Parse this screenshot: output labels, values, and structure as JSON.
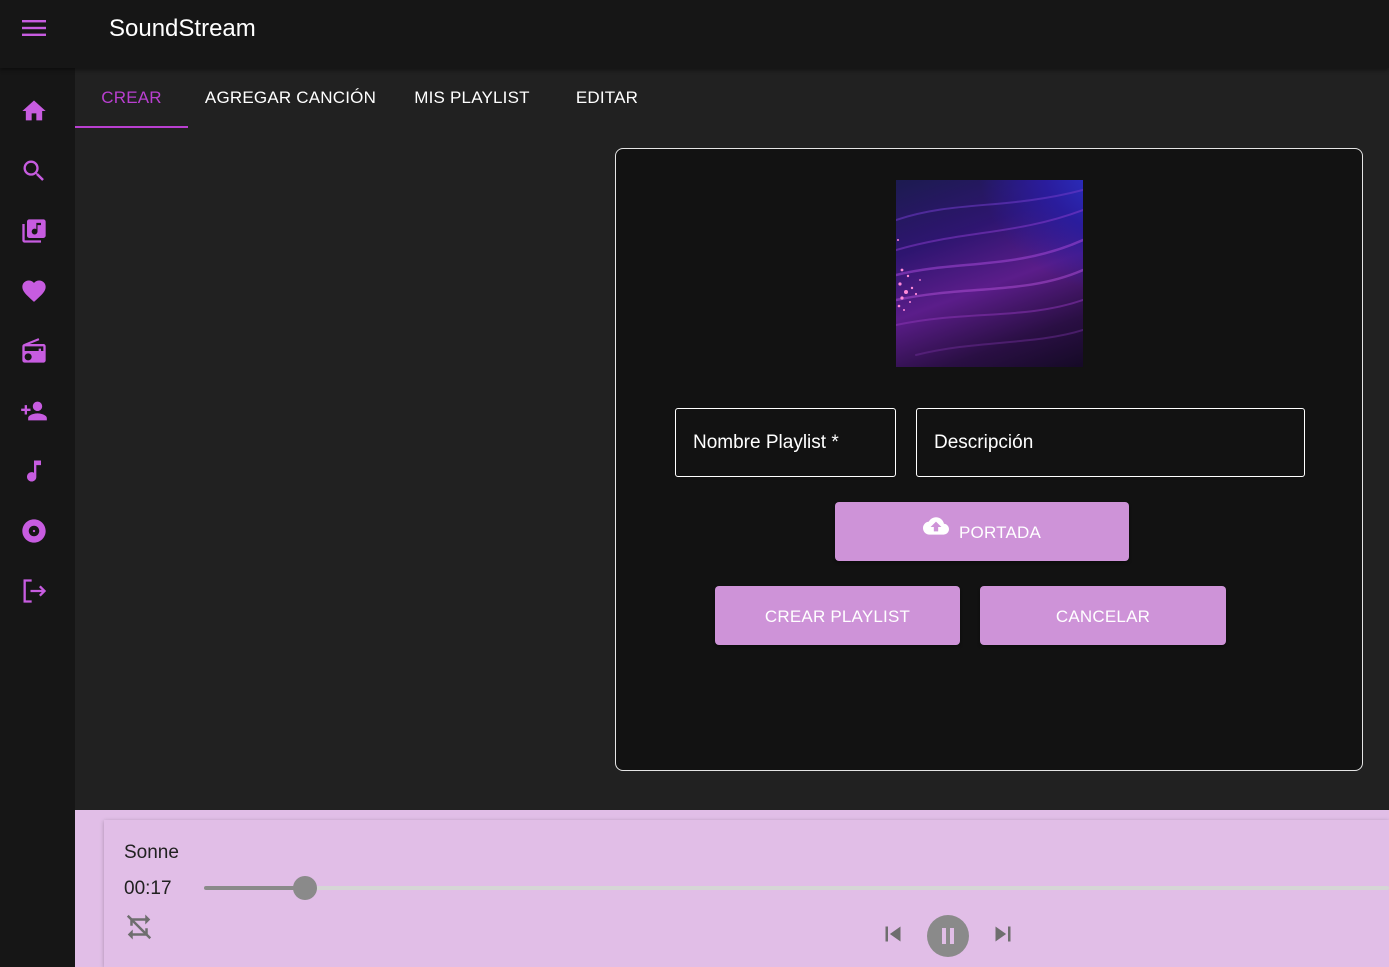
{
  "app": {
    "title": "SoundStream"
  },
  "sidebar": {
    "items": [
      {
        "icon": "home-icon"
      },
      {
        "icon": "search-icon"
      },
      {
        "icon": "library-music-icon"
      },
      {
        "icon": "heart-icon"
      },
      {
        "icon": "radio-icon"
      },
      {
        "icon": "person-add-icon"
      },
      {
        "icon": "music-note-icon"
      },
      {
        "icon": "album-icon"
      },
      {
        "icon": "logout-icon"
      }
    ]
  },
  "tabs": [
    {
      "label": "CREAR",
      "active": true
    },
    {
      "label": "AGREGAR CANCIÓN",
      "active": false
    },
    {
      "label": "MIS PLAYLIST",
      "active": false
    },
    {
      "label": "EDITAR",
      "active": false
    }
  ],
  "form": {
    "name_placeholder": "Nombre Playlist *",
    "name_value": "",
    "description_placeholder": "Descripción",
    "description_value": "",
    "cover_button": "PORTADA",
    "create_button": "CREAR PLAYLIST",
    "cancel_button": "CANCELAR"
  },
  "player": {
    "track_title": "Sonne",
    "elapsed": "00:17",
    "progress": 0.085
  },
  "colors": {
    "accent": "#b93fd0",
    "button": "#ce93d8",
    "player_bg": "#e1bee7",
    "sidebar_icon": "#c75ce0"
  }
}
